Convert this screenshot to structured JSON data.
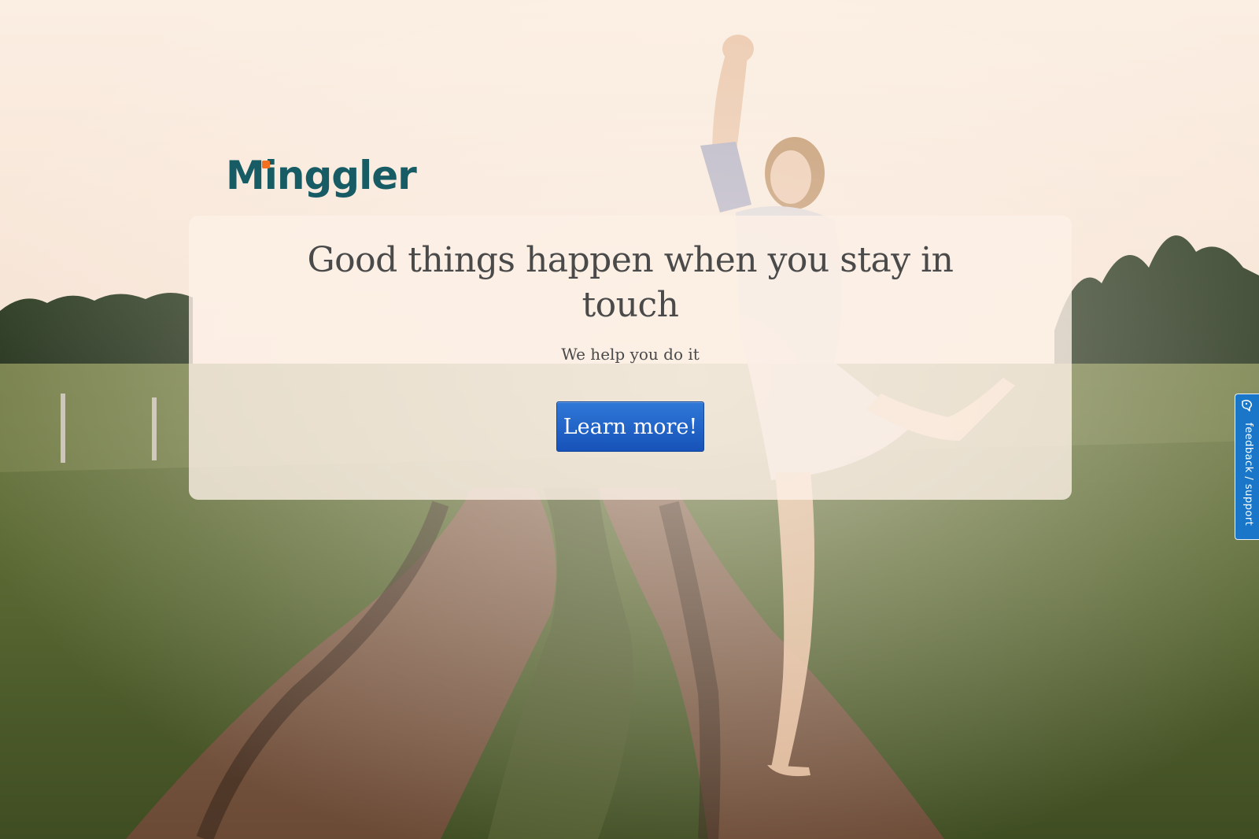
{
  "brand": {
    "logo_text": "Minggler",
    "logo_accent_color": "#f37021",
    "logo_color": "#175b64"
  },
  "hero": {
    "title": "Good things happen when you stay in touch",
    "subtitle": "We help you do it",
    "cta_label": "Learn more!"
  },
  "feedback": {
    "label": "feedback / support",
    "icon": "feedback-icon",
    "color": "#1a76c9"
  },
  "background": {
    "description_icon": "background-photo"
  }
}
